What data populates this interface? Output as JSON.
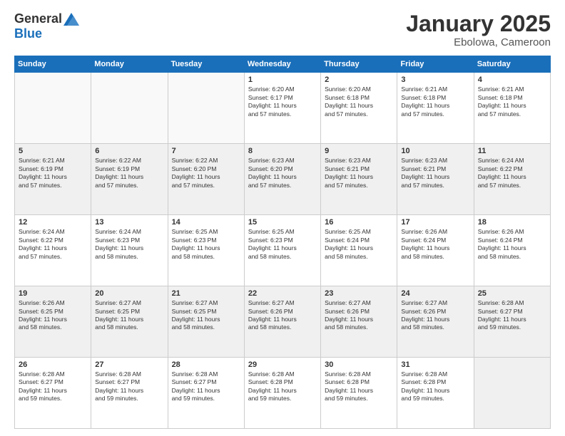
{
  "logo": {
    "general": "General",
    "blue": "Blue"
  },
  "title": "January 2025",
  "location": "Ebolowa, Cameroon",
  "headers": [
    "Sunday",
    "Monday",
    "Tuesday",
    "Wednesday",
    "Thursday",
    "Friday",
    "Saturday"
  ],
  "weeks": [
    [
      {
        "day": "",
        "info": ""
      },
      {
        "day": "",
        "info": ""
      },
      {
        "day": "",
        "info": ""
      },
      {
        "day": "1",
        "info": "Sunrise: 6:20 AM\nSunset: 6:17 PM\nDaylight: 11 hours\nand 57 minutes."
      },
      {
        "day": "2",
        "info": "Sunrise: 6:20 AM\nSunset: 6:18 PM\nDaylight: 11 hours\nand 57 minutes."
      },
      {
        "day": "3",
        "info": "Sunrise: 6:21 AM\nSunset: 6:18 PM\nDaylight: 11 hours\nand 57 minutes."
      },
      {
        "day": "4",
        "info": "Sunrise: 6:21 AM\nSunset: 6:18 PM\nDaylight: 11 hours\nand 57 minutes."
      }
    ],
    [
      {
        "day": "5",
        "info": "Sunrise: 6:21 AM\nSunset: 6:19 PM\nDaylight: 11 hours\nand 57 minutes."
      },
      {
        "day": "6",
        "info": "Sunrise: 6:22 AM\nSunset: 6:19 PM\nDaylight: 11 hours\nand 57 minutes."
      },
      {
        "day": "7",
        "info": "Sunrise: 6:22 AM\nSunset: 6:20 PM\nDaylight: 11 hours\nand 57 minutes."
      },
      {
        "day": "8",
        "info": "Sunrise: 6:23 AM\nSunset: 6:20 PM\nDaylight: 11 hours\nand 57 minutes."
      },
      {
        "day": "9",
        "info": "Sunrise: 6:23 AM\nSunset: 6:21 PM\nDaylight: 11 hours\nand 57 minutes."
      },
      {
        "day": "10",
        "info": "Sunrise: 6:23 AM\nSunset: 6:21 PM\nDaylight: 11 hours\nand 57 minutes."
      },
      {
        "day": "11",
        "info": "Sunrise: 6:24 AM\nSunset: 6:22 PM\nDaylight: 11 hours\nand 57 minutes."
      }
    ],
    [
      {
        "day": "12",
        "info": "Sunrise: 6:24 AM\nSunset: 6:22 PM\nDaylight: 11 hours\nand 57 minutes."
      },
      {
        "day": "13",
        "info": "Sunrise: 6:24 AM\nSunset: 6:23 PM\nDaylight: 11 hours\nand 58 minutes."
      },
      {
        "day": "14",
        "info": "Sunrise: 6:25 AM\nSunset: 6:23 PM\nDaylight: 11 hours\nand 58 minutes."
      },
      {
        "day": "15",
        "info": "Sunrise: 6:25 AM\nSunset: 6:23 PM\nDaylight: 11 hours\nand 58 minutes."
      },
      {
        "day": "16",
        "info": "Sunrise: 6:25 AM\nSunset: 6:24 PM\nDaylight: 11 hours\nand 58 minutes."
      },
      {
        "day": "17",
        "info": "Sunrise: 6:26 AM\nSunset: 6:24 PM\nDaylight: 11 hours\nand 58 minutes."
      },
      {
        "day": "18",
        "info": "Sunrise: 6:26 AM\nSunset: 6:24 PM\nDaylight: 11 hours\nand 58 minutes."
      }
    ],
    [
      {
        "day": "19",
        "info": "Sunrise: 6:26 AM\nSunset: 6:25 PM\nDaylight: 11 hours\nand 58 minutes."
      },
      {
        "day": "20",
        "info": "Sunrise: 6:27 AM\nSunset: 6:25 PM\nDaylight: 11 hours\nand 58 minutes."
      },
      {
        "day": "21",
        "info": "Sunrise: 6:27 AM\nSunset: 6:25 PM\nDaylight: 11 hours\nand 58 minutes."
      },
      {
        "day": "22",
        "info": "Sunrise: 6:27 AM\nSunset: 6:26 PM\nDaylight: 11 hours\nand 58 minutes."
      },
      {
        "day": "23",
        "info": "Sunrise: 6:27 AM\nSunset: 6:26 PM\nDaylight: 11 hours\nand 58 minutes."
      },
      {
        "day": "24",
        "info": "Sunrise: 6:27 AM\nSunset: 6:26 PM\nDaylight: 11 hours\nand 58 minutes."
      },
      {
        "day": "25",
        "info": "Sunrise: 6:28 AM\nSunset: 6:27 PM\nDaylight: 11 hours\nand 59 minutes."
      }
    ],
    [
      {
        "day": "26",
        "info": "Sunrise: 6:28 AM\nSunset: 6:27 PM\nDaylight: 11 hours\nand 59 minutes."
      },
      {
        "day": "27",
        "info": "Sunrise: 6:28 AM\nSunset: 6:27 PM\nDaylight: 11 hours\nand 59 minutes."
      },
      {
        "day": "28",
        "info": "Sunrise: 6:28 AM\nSunset: 6:27 PM\nDaylight: 11 hours\nand 59 minutes."
      },
      {
        "day": "29",
        "info": "Sunrise: 6:28 AM\nSunset: 6:28 PM\nDaylight: 11 hours\nand 59 minutes."
      },
      {
        "day": "30",
        "info": "Sunrise: 6:28 AM\nSunset: 6:28 PM\nDaylight: 11 hours\nand 59 minutes."
      },
      {
        "day": "31",
        "info": "Sunrise: 6:28 AM\nSunset: 6:28 PM\nDaylight: 11 hours\nand 59 minutes."
      },
      {
        "day": "",
        "info": ""
      }
    ]
  ]
}
